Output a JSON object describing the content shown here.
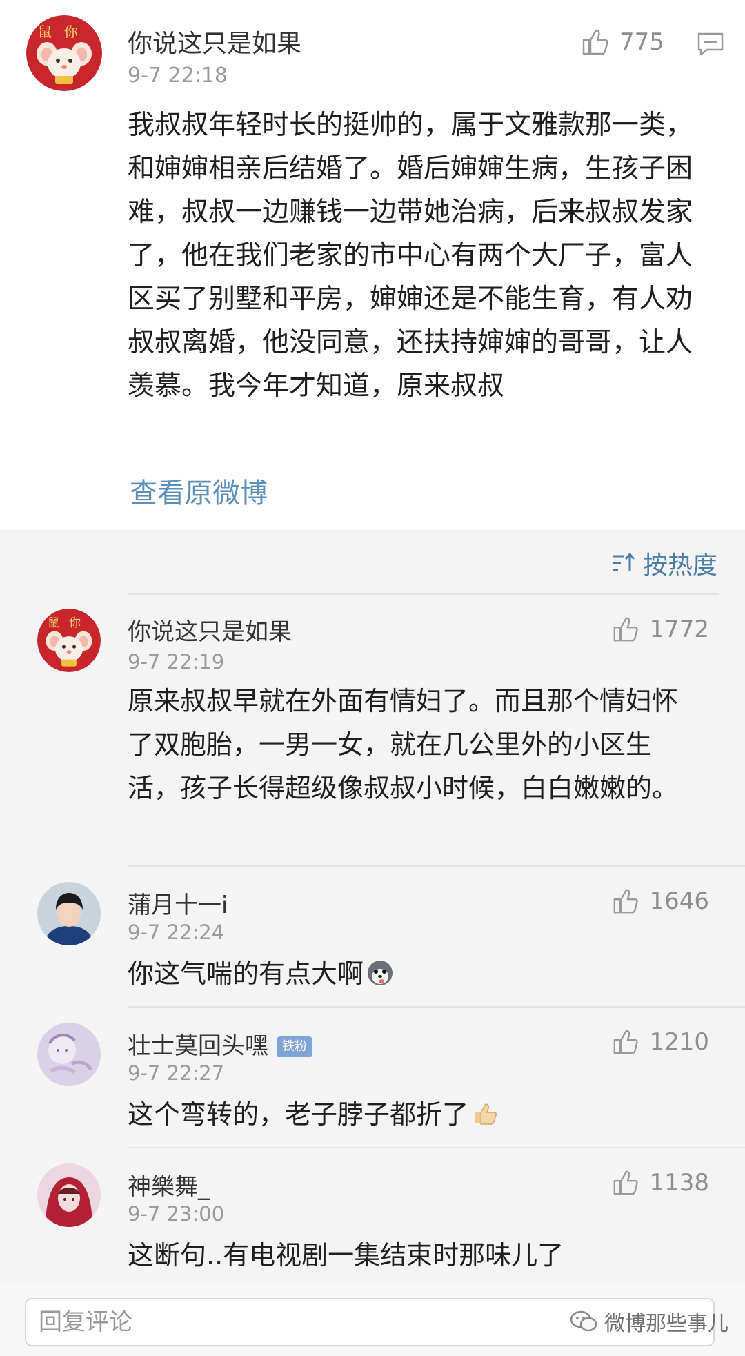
{
  "main_comment": {
    "username": "你说这只是如果",
    "time": "9-7 22:18",
    "likes": "775",
    "text": "我叔叔年轻时长的挺帅的，属于文雅款那一类，和婶婶相亲后结婚了。婚后婶婶生病，生孩子困难，叔叔一边赚钱一边带她治病，后来叔叔发家了，他在我们老家的市中心有两个大厂子，富人区买了别墅和平房，婶婶还是不能生育，有人劝叔叔离婚，他没同意，还扶持婶婶的哥哥，让人羡慕。我今年才知道，原来叔叔",
    "view_original": "查看原微博",
    "avatar_text": "鼠你"
  },
  "sort": {
    "label": "按热度"
  },
  "replies": [
    {
      "username": "你说这只是如果",
      "time": "9-7 22:19",
      "likes": "1772",
      "text": "原来叔叔早就在外面有情妇了。而且那个情妇怀了双胞胎，一男一女，就在几公里外的小区生活，孩子长得超级像叔叔小时候，白白嫩嫩的。",
      "avatar_text": "鼠你"
    },
    {
      "username": "蒲月十一i",
      "time": "9-7 22:24",
      "likes": "1646",
      "text": "你这气喘的有点大啊",
      "emoji": "husky-emoji"
    },
    {
      "username": "壮士莫回头嘿",
      "badge": "铁粉",
      "time": "9-7 22:27",
      "likes": "1210",
      "text": "这个弯转的，老子脖子都折了",
      "emoji": "thumbs-up-emoji"
    },
    {
      "username": "神樂舞_",
      "time": "9-7 23:00",
      "likes": "1138",
      "text": "这断句..有电视剧一集结束时那味儿了"
    }
  ],
  "bottom_bar": {
    "placeholder": "回复评论",
    "watermark": "微博那些事儿"
  },
  "colors": {
    "link": "#5b8fb9",
    "sort": "#4d7ea8",
    "badge": "#7fa4d7",
    "muted": "#9a9a9a"
  }
}
